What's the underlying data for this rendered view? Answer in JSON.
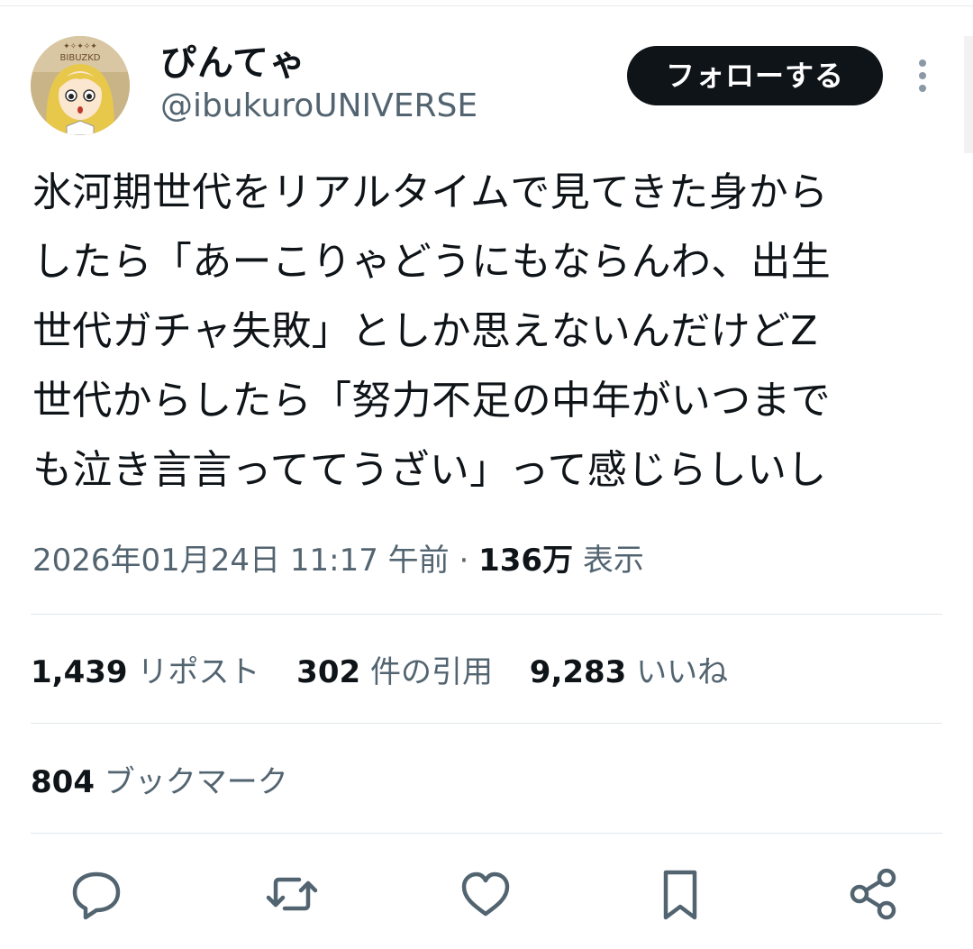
{
  "user": {
    "display_name": "ぴんてゃ",
    "handle": "@ibukuroUNIVERSE",
    "avatar_text": "BIBUZKD"
  },
  "follow_label": "フォローする",
  "tweet": {
    "lines": [
      "氷河期世代をリアルタイムで見てきた身から",
      "したら「あーこりゃどうにもならんわ、出生",
      "世代ガチャ失敗」としか思えないんだけどZ",
      "世代からしたら「努力不足の中年がいつまで",
      "も泣き言言っててうざい」って感じらしいし"
    ]
  },
  "meta": {
    "timestamp": "2026年01月24日 11:17 午前",
    "separator": "·",
    "views_count": "136万",
    "views_label": "表示"
  },
  "stats": {
    "reposts_count": "1,439",
    "reposts_label": "リポスト",
    "quotes_count": "302",
    "quotes_label": "件の引用",
    "likes_count": "9,283",
    "likes_label": "いいね",
    "bookmarks_count": "804",
    "bookmarks_label": "ブックマーク"
  },
  "icons": {
    "reply": "reply-icon",
    "repost": "repost-icon",
    "like": "heart-icon",
    "bookmark": "bookmark-icon",
    "share": "share-icon",
    "more": "more-vertical-icon"
  },
  "colors": {
    "text": "#0f1419",
    "secondary": "#536471",
    "follow_bg": "#0f1419",
    "divider": "#e1e6ea"
  }
}
